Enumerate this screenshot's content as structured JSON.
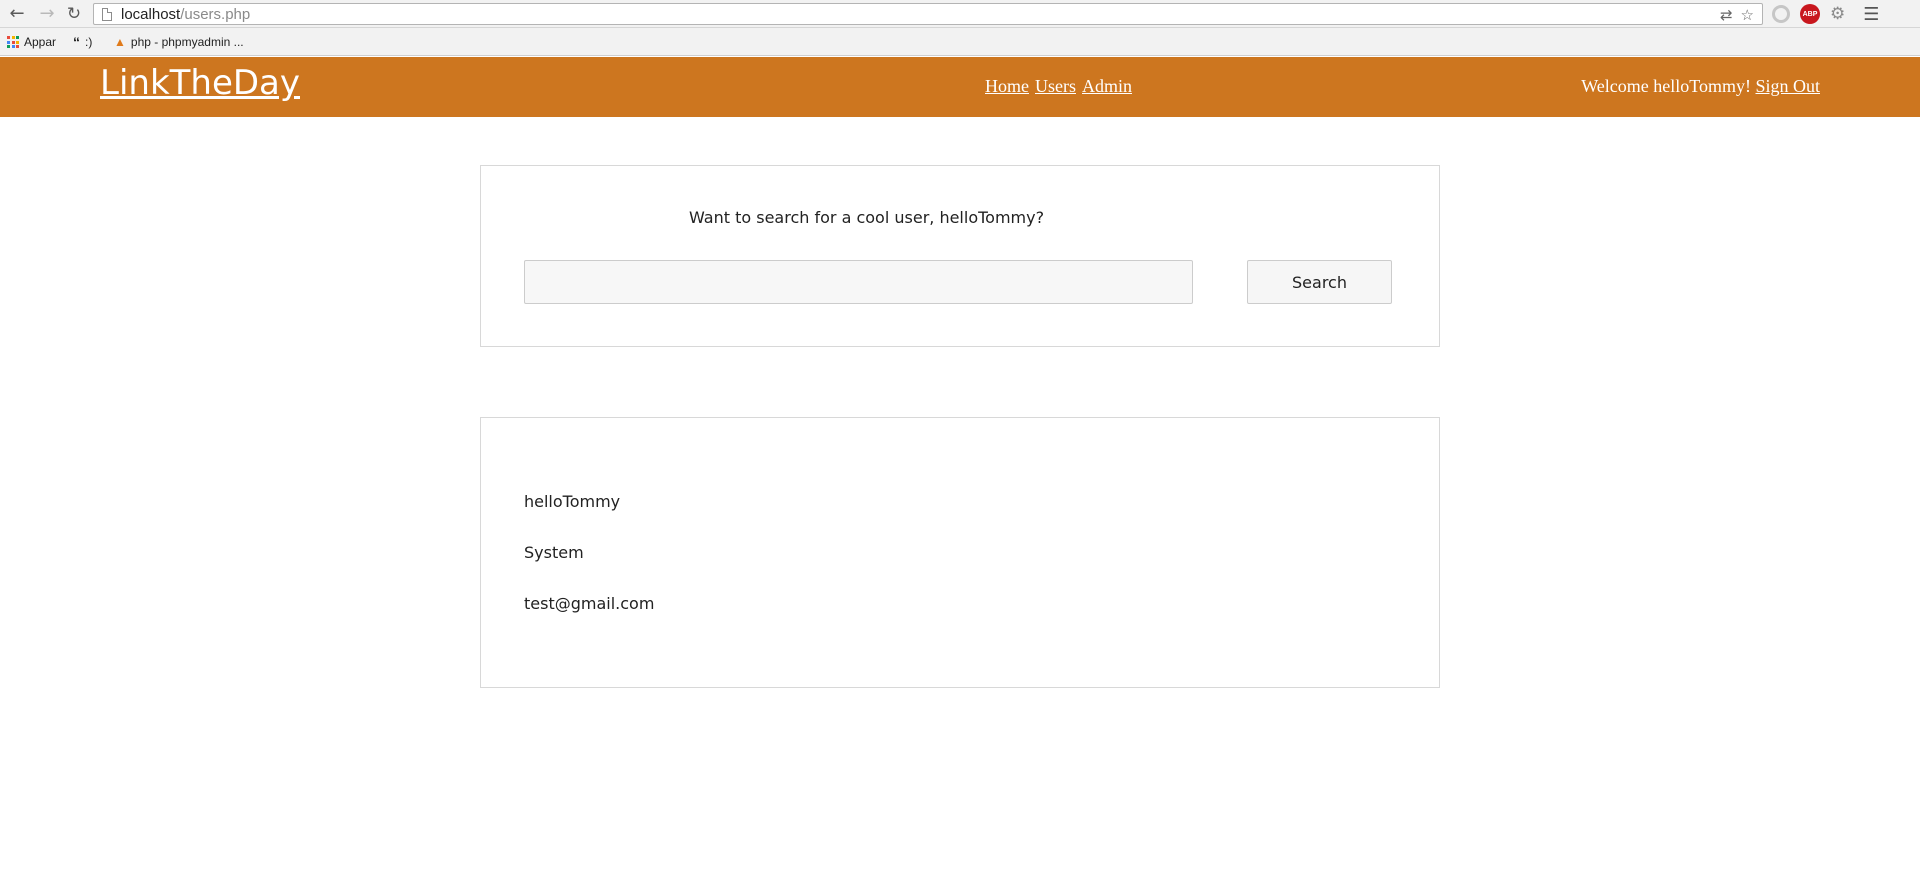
{
  "browser": {
    "url_host": "localhost",
    "url_path": "/users.php",
    "back_icon": "arrow-left-icon",
    "forward_icon": "arrow-right-icon",
    "reload_icon": "reload-icon",
    "omnibox_icons": [
      "translate-icon",
      "star-icon"
    ],
    "extension_icons": [
      "circle-extension-icon",
      "adblock-plus-icon",
      "puzzle-extension-icon",
      "chrome-menu-icon"
    ],
    "adblock_label": "ABP",
    "bookmarks": [
      {
        "label": "Appar",
        "icon": "apps-grid-icon"
      },
      {
        "label": ":)",
        "icon": "quote-icon"
      },
      {
        "label": "php - phpmyadmin ...",
        "icon": "php-icon"
      }
    ]
  },
  "header": {
    "brand": "LinkTheDay",
    "nav": [
      "Home",
      "Users",
      "Admin"
    ],
    "welcome": "Welcome helloTommy!",
    "sign_out": "Sign Out",
    "background_color": "#cd761f"
  },
  "search": {
    "prompt": "Want to search for a cool user, helloTommy?",
    "input_value": "",
    "button_label": "Search"
  },
  "results": {
    "lines": [
      "helloTommy",
      "System",
      "test@gmail.com"
    ]
  }
}
